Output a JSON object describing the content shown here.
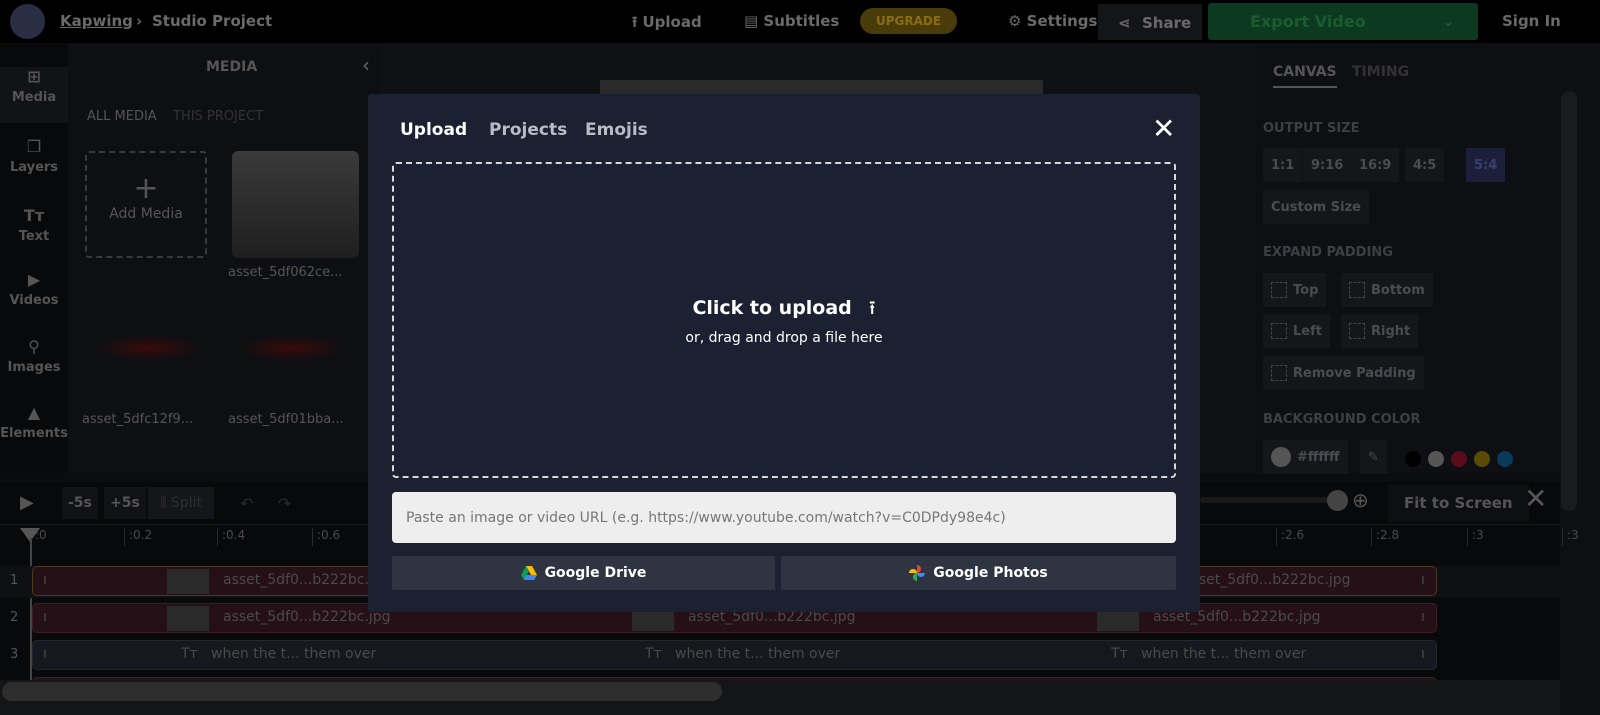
{
  "header": {
    "brand": "Kapwing",
    "separator": "›",
    "project": "Studio Project",
    "upload": "Upload",
    "subtitles": "Subtitles",
    "upgrade": "UPGRADE",
    "settings": "Settings",
    "share": "Share",
    "export": "Export Video",
    "sign_in": "Sign In"
  },
  "sidebar": {
    "items": [
      {
        "label": "Media",
        "icon": "media-icon"
      },
      {
        "label": "Layers",
        "icon": "layers-icon"
      },
      {
        "label": "Text",
        "icon": "text-icon"
      },
      {
        "label": "Videos",
        "icon": "videos-icon"
      },
      {
        "label": "Images",
        "icon": "images-icon"
      },
      {
        "label": "Elements",
        "icon": "elements-icon"
      }
    ]
  },
  "media": {
    "title": "MEDIA",
    "tabs": [
      "ALL MEDIA",
      "THIS PROJECT"
    ],
    "add": "Add Media",
    "assets": [
      "asset_5df062ce...",
      "asset_5dfc12f9...",
      "asset_5df01bba..."
    ]
  },
  "right": {
    "tabs": [
      "CANVAS",
      "TIMING"
    ],
    "output_size": "OUTPUT SIZE",
    "sizes": [
      "1:1",
      "9:16",
      "16:9",
      "4:5",
      "5:4"
    ],
    "selected_size": "5:4",
    "custom": "Custom Size",
    "expand_padding": "EXPAND PADDING",
    "padding": [
      "Top",
      "Bottom",
      "Left",
      "Right",
      "Remove Padding"
    ],
    "bg_color_label": "BACKGROUND COLOR",
    "bg_color": "#ffffff",
    "bg_color_text": "#ffffff"
  },
  "timeline": {
    "back": "-5s",
    "fwd": "+5s",
    "split": "Split",
    "fit": "Fit to Screen",
    "ticks": [
      ":0",
      ":0.2",
      ":0.4",
      ":0.6",
      ":2.6",
      ":2.8",
      ":3",
      ":3"
    ],
    "rows": [
      "1",
      "2",
      "3"
    ],
    "clip_image": "asset_5df0...b222bc.jpg",
    "clip_text": "when the t... them over"
  },
  "modal": {
    "tabs": [
      "Upload",
      "Projects",
      "Emojis"
    ],
    "active_tab": "Upload",
    "click_upload": "Click to upload",
    "drag_drop": "or, drag and drop a file here",
    "url_placeholder": "Paste an image or video URL (e.g. https://www.youtube.com/watch?v=C0DPdy98e4c)",
    "google_drive": "Google Drive",
    "google_photos": "Google Photos"
  }
}
